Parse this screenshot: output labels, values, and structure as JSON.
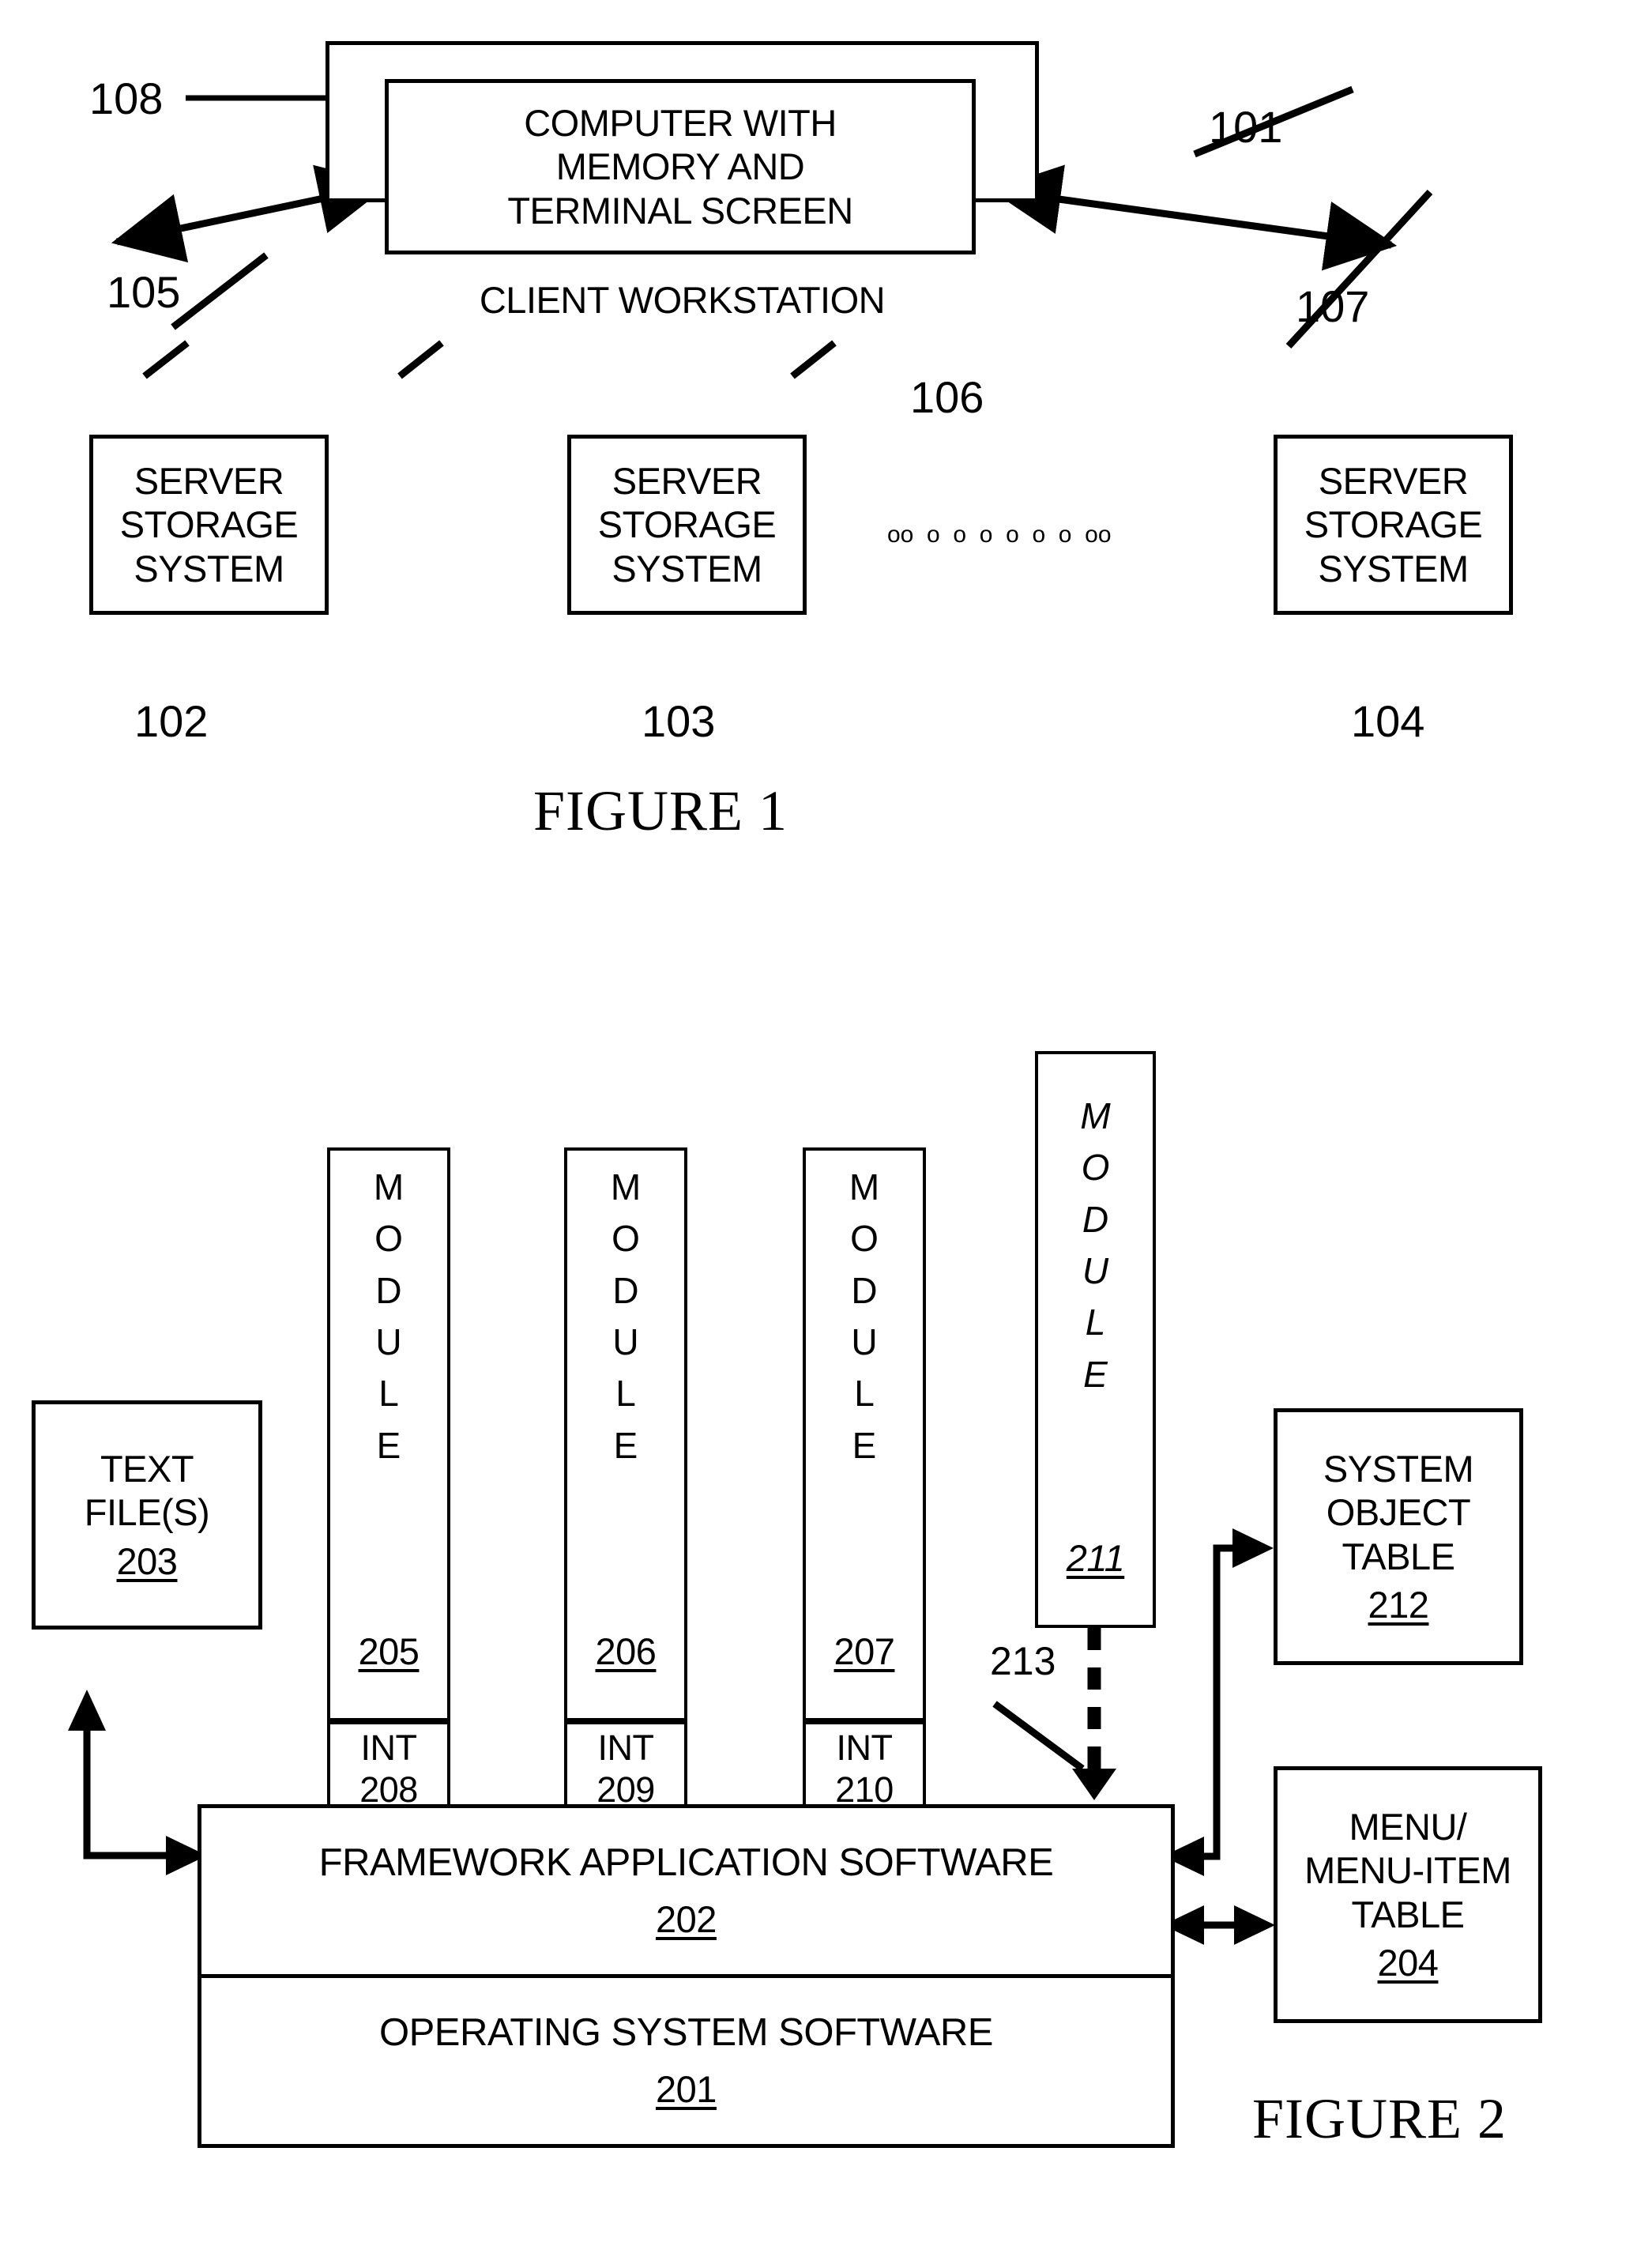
{
  "figure1": {
    "caption": "FIGURE 1",
    "client_workstation": {
      "inner_label": "COMPUTER WITH\nMEMORY AND\nTERMINAL SCREEN",
      "inner_line1": "COMPUTER WITH",
      "inner_line2": "MEMORY AND",
      "inner_line3": "TERMINAL SCREEN",
      "outer_label": "CLIENT WORKSTATION",
      "outer_ref": "101",
      "inner_ref": "108"
    },
    "servers": [
      {
        "line1": "SERVER",
        "line2": "STORAGE",
        "line3": "SYSTEM",
        "ref": "102",
        "link_ref": "105"
      },
      {
        "line1": "SERVER",
        "line2": "STORAGE",
        "line3": "SYSTEM",
        "ref": "103",
        "link_ref": "106"
      },
      {
        "line1": "SERVER",
        "line2": "STORAGE",
        "line3": "SYSTEM",
        "ref": "104",
        "link_ref": "107"
      }
    ],
    "ellipsis": "oo  o  o  o  o  o  o  oo"
  },
  "figure2": {
    "caption": "FIGURE 2",
    "text_files": {
      "line1": "TEXT",
      "line2": "FILE(S)",
      "ref": "203"
    },
    "modules": [
      {
        "letters": [
          "M",
          "O",
          "D",
          "U",
          "L",
          "E"
        ],
        "ref": "205",
        "int_label": "INT",
        "int_ref": "208",
        "italic": false
      },
      {
        "letters": [
          "M",
          "O",
          "D",
          "U",
          "L",
          "E"
        ],
        "ref": "206",
        "int_label": "INT",
        "int_ref": "209",
        "italic": false
      },
      {
        "letters": [
          "M",
          "O",
          "D",
          "U",
          "L",
          "E"
        ],
        "ref": "207",
        "int_label": "INT",
        "int_ref": "210",
        "italic": false
      }
    ],
    "new_module": {
      "letters": [
        "M",
        "O",
        "D",
        "U",
        "L",
        "E"
      ],
      "ref": "211",
      "italic": true
    },
    "install_arrow_ref": "213",
    "framework": {
      "label": "FRAMEWORK APPLICATION SOFTWARE",
      "ref": "202"
    },
    "operating_system": {
      "label": "OPERATING SYSTEM SOFTWARE",
      "ref": "201"
    },
    "system_object_table": {
      "line1": "SYSTEM",
      "line2": "OBJECT",
      "line3": "TABLE",
      "ref": "212"
    },
    "menu_table": {
      "line1": "MENU/",
      "line2": "MENU-ITEM",
      "line3": "TABLE",
      "ref": "204"
    }
  },
  "colors": {
    "ink": "#000000",
    "paper": "#ffffff"
  }
}
